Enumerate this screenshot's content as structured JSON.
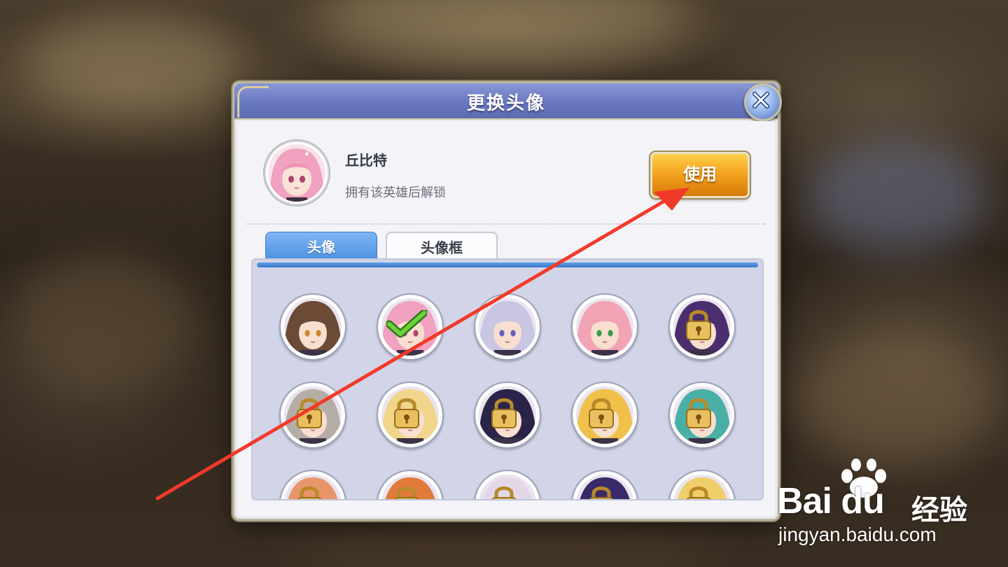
{
  "dialog": {
    "title": "更换头像",
    "close_icon": "close-icon"
  },
  "selected_hero": {
    "name": "丘比特",
    "unlock_hint": "拥有该英雄后解锁",
    "use_label": "使用"
  },
  "tabs": [
    {
      "label": "头像",
      "active": true
    },
    {
      "label": "头像框",
      "active": false
    }
  ],
  "avatars": [
    {
      "hero": "brown-hair-male",
      "state": "unlocked",
      "hair": "#6b4a36",
      "eye": "#c98a2a"
    },
    {
      "hero": "pink-hair-girl",
      "state": "selected",
      "hair": "#f0a2c0",
      "eye": "#b04470"
    },
    {
      "hero": "silver-hair-captain",
      "state": "unlocked",
      "hair": "#c9c6e4",
      "eye": "#6a5fc0"
    },
    {
      "hero": "pink-bun-girl",
      "state": "unlocked",
      "hair": "#f2a4b6",
      "eye": "#3a9a4a"
    },
    {
      "hero": "purple-hair-male",
      "state": "locked",
      "hair": "#4a2e6e",
      "eye": "#7a4ab0"
    },
    {
      "hero": "silver-long-hair",
      "state": "locked",
      "hair": "#b6aea6",
      "eye": "#8a3a3a"
    },
    {
      "hero": "blonde-girl",
      "state": "locked",
      "hair": "#f0d58a",
      "eye": "#3a6ab8"
    },
    {
      "hero": "dark-hair-witch",
      "state": "locked",
      "hair": "#2a2448",
      "eye": "#8a5ac0"
    },
    {
      "hero": "blonde-red-outfit",
      "state": "locked",
      "hair": "#f0c04a",
      "eye": "#b04a2a"
    },
    {
      "hero": "teal-hair-girl",
      "state": "locked",
      "hair": "#4ab0a6",
      "eye": "#7a3a9a"
    },
    {
      "hero": "orange-hair-a",
      "state": "locked",
      "hair": "#e8956a",
      "eye": "#aa5530"
    },
    {
      "hero": "orange-hair-b",
      "state": "locked",
      "hair": "#e27a3a",
      "eye": "#aa5530"
    },
    {
      "hero": "white-hat-girl",
      "state": "locked",
      "hair": "#e4d8e8",
      "eye": "#7a6aa0"
    },
    {
      "hero": "purple-hat-girl",
      "state": "locked",
      "hair": "#3a2a6a",
      "eye": "#7a5ab0"
    },
    {
      "hero": "golden-hair",
      "state": "locked",
      "hair": "#f0cf6a",
      "eye": "#aa7a2a"
    }
  ],
  "annotation": {
    "arrow_color": "#f23a2a"
  },
  "watermark": {
    "logo": "Bai du",
    "logo_cn": "经验",
    "url": "jingyan.baidu.com"
  },
  "colors": {
    "title_bar": "#6a78bf",
    "use_button": "#f3a01c",
    "tab_active": "#4a8fe0",
    "panel": "#d2d5e8"
  }
}
